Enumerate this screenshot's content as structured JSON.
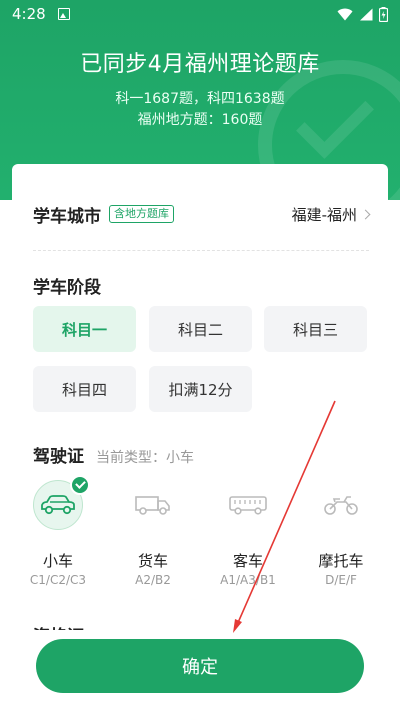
{
  "status": {
    "time": "4:28"
  },
  "header": {
    "title": "已同步4月福州理论题库",
    "line1": "科一1687题，科四1638题",
    "line2": "福州地方题：160题"
  },
  "city": {
    "label": "学车城市",
    "tag": "含地方题库",
    "value": "福建-福州"
  },
  "stage": {
    "title": "学车阶段",
    "options": [
      {
        "label": "科目一",
        "selected": true
      },
      {
        "label": "科目二"
      },
      {
        "label": "科目三"
      },
      {
        "label": "科目四"
      },
      {
        "label": "扣满12分"
      }
    ]
  },
  "license": {
    "title": "驾驶证",
    "current": "当前类型：小车",
    "vehicles": [
      {
        "name": "小车",
        "codes": "C1/C2/C3",
        "icon": "car-icon",
        "selected": true
      },
      {
        "name": "货车",
        "codes": "A2/B2",
        "icon": "truck-icon"
      },
      {
        "name": "客车",
        "codes": "A1/A3/B1",
        "icon": "bus-icon"
      },
      {
        "name": "摩托车",
        "codes": "D/E/F",
        "icon": "motorcycle-icon"
      }
    ]
  },
  "next_section_partial": "资格证",
  "confirm_label": "确定",
  "colors": {
    "primary": "#1ea466",
    "arrow": "#e53935"
  }
}
